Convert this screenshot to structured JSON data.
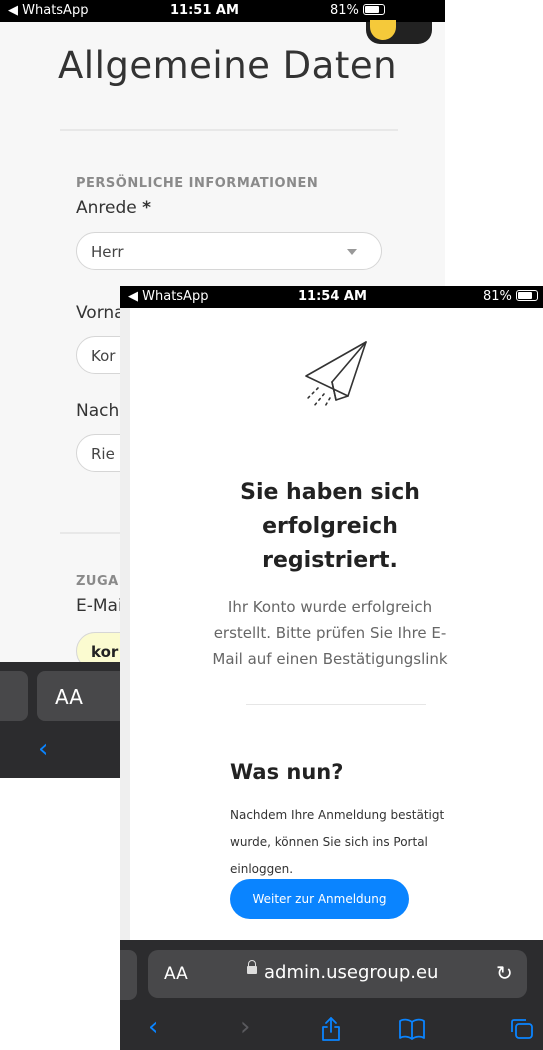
{
  "screen1": {
    "status": {
      "back": "◀ WhatsApp",
      "time": "11:51 AM",
      "battery": "81%"
    },
    "page_title": "Allgemeine Daten",
    "section_personal": "PERSÖNLICHE INFORMATIONEN",
    "anrede_label": "Anrede",
    "required_mark": "*",
    "anrede_value": "Herr",
    "vorname_label": "Vorna",
    "vorname_value": "Kor",
    "nachname_label": "Nach",
    "nachname_value": "Rie",
    "section_access": "ZUGA",
    "email_label": "E-Mai",
    "email_value": "kor",
    "aa_label": "AA",
    "back_icon": "chevron-left-icon"
  },
  "screen2": {
    "status": {
      "back": "◀ WhatsApp",
      "time": "11:54 AM",
      "battery": "81%"
    },
    "icon": "paper-plane-icon",
    "title_line1": "Sie haben sich",
    "title_line2": "erfolgreich",
    "title_line3": "registriert.",
    "sub_line1": "Ihr Konto wurde erfolgreich",
    "sub_line2": "erstellt. Bitte prüfen Sie Ihre E-",
    "sub_line3": "Mail auf einen Bestätigungslink",
    "next_title": "Was nun?",
    "desc_line1": "Nachdem Ihre Anmeldung bestätigt",
    "desc_line2": "wurde, können Sie sich ins Portal",
    "desc_line3": "einloggen.",
    "cta_label": "Weiter zur Anmeldung",
    "url_aa": "AA",
    "url_host": "admin.usegroup.eu",
    "reload": "↻",
    "tabs": {
      "back": "‹",
      "forward": "›",
      "share": "⇧",
      "bookmarks": "📖",
      "tabs": "⧉"
    }
  },
  "colors": {
    "accent": "#0a84ff",
    "dark_bar": "#2c2c2e"
  }
}
